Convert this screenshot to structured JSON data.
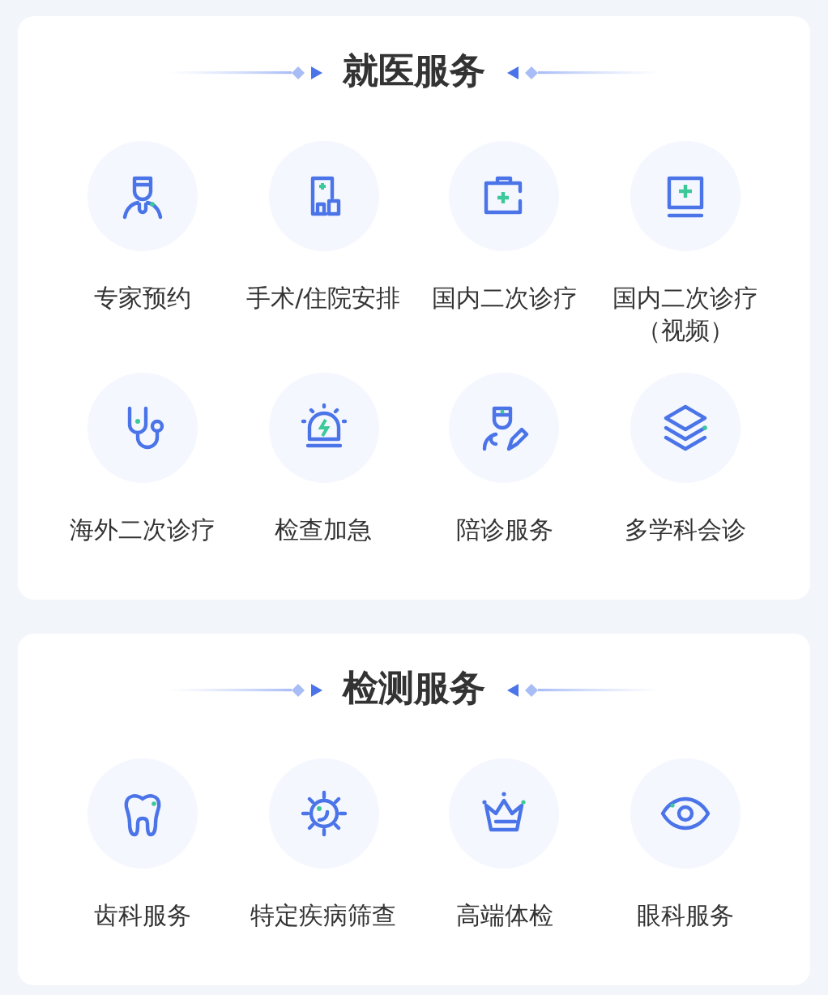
{
  "sections": [
    {
      "title": "就医服务",
      "items": [
        {
          "label": "专家预约"
        },
        {
          "label": "手术/住院安排"
        },
        {
          "label": "国内二次诊疗"
        },
        {
          "label": "国内二次诊疗（视频）"
        },
        {
          "label": "海外二次诊疗"
        },
        {
          "label": "检查加急"
        },
        {
          "label": "陪诊服务"
        },
        {
          "label": "多学科会诊"
        }
      ]
    },
    {
      "title": "检测服务",
      "items": [
        {
          "label": "齿科服务"
        },
        {
          "label": "特定疾病筛查"
        },
        {
          "label": "高端体检"
        },
        {
          "label": "眼科服务"
        }
      ]
    }
  ]
}
